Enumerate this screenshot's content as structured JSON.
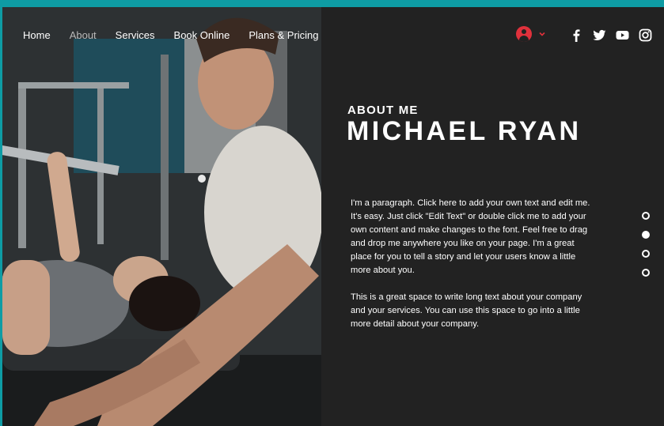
{
  "nav": {
    "items": [
      {
        "label": "Home",
        "active": false
      },
      {
        "label": "About",
        "active": true
      },
      {
        "label": "Services",
        "active": false
      },
      {
        "label": "Book Online",
        "active": false
      },
      {
        "label": "Plans & Pricing",
        "active": false
      }
    ]
  },
  "account": {
    "icon": "user-avatar-icon",
    "accent": "#e0313c"
  },
  "social": [
    {
      "icon": "facebook-icon"
    },
    {
      "icon": "twitter-icon"
    },
    {
      "icon": "youtube-icon"
    },
    {
      "icon": "instagram-icon"
    }
  ],
  "content": {
    "eyebrow": "ABOUT ME",
    "title": "MICHAEL RYAN",
    "paragraph1": "I'm a paragraph. Click here to add your own text and edit me. It's easy. Just click \"Edit Text\" or double click me to add your own content and make changes to the font. Feel free to drag and drop me anywhere you like on your page. I'm a great place for you to tell a story and let your users know a little more about you.",
    "paragraph2": "This is a great space to write long text about your company and your services. You can use this space to go into a little more detail about your company."
  },
  "section_dots": {
    "count": 4,
    "active_index": 1
  },
  "colors": {
    "frame": "#0e9ca4",
    "panel": "#222222",
    "text": "#ffffff",
    "accent": "#e0313c"
  }
}
